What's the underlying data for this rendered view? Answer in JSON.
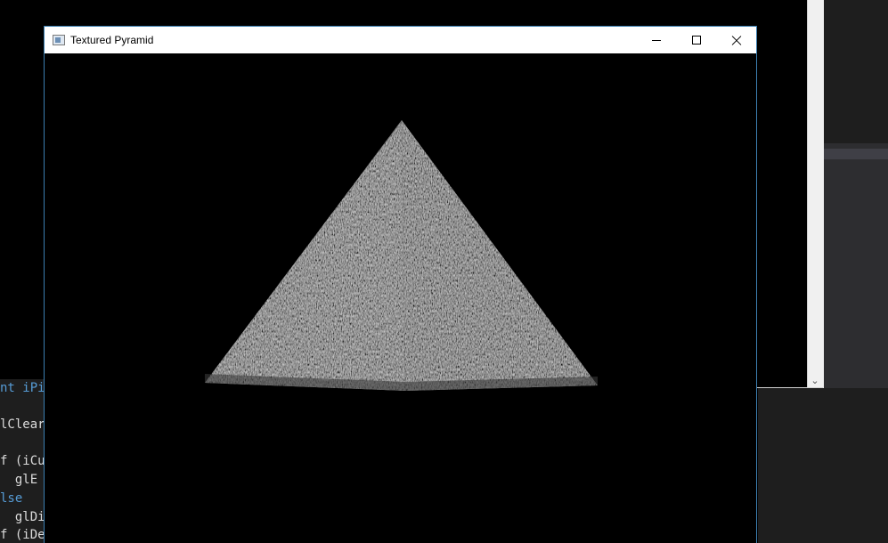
{
  "window": {
    "title": "Textured Pyramid",
    "icon": "app-window-icon",
    "controls": {
      "minimize_icon": "minimize-icon",
      "maximize_icon": "maximize-icon",
      "close_icon": "close-icon"
    }
  },
  "scene": {
    "background_color": "#000000",
    "object": "pyramid",
    "texture_color": "#6b6b6b"
  },
  "background_console": {
    "scroll_down_glyph": "⌄"
  },
  "background_code": {
    "lines": [
      {
        "text": "nt iPi",
        "kind": "kw"
      },
      {
        "text": "",
        "kind": "plain"
      },
      {
        "text": "lClear",
        "kind": "plain"
      },
      {
        "text": "",
        "kind": "plain"
      },
      {
        "text": "f (iCul",
        "kind": "plain"
      },
      {
        "text": "  glE",
        "kind": "plain"
      },
      {
        "text": "lse",
        "kind": "kw"
      },
      {
        "text": "  glDi",
        "kind": "plain"
      },
      {
        "text": "f (iDep",
        "kind": "plain"
      }
    ]
  }
}
